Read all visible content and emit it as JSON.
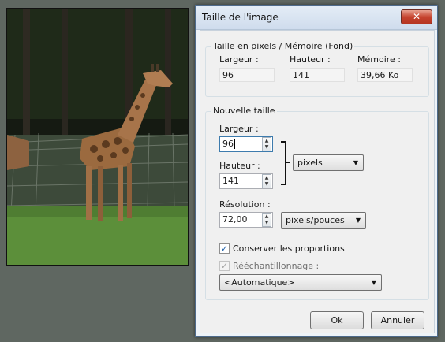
{
  "dialog": {
    "title": "Taille de l'image",
    "close_glyph": "✕"
  },
  "memory_group": {
    "legend": "Taille en pixels / Mémoire (Fond)",
    "width_label": "Largeur :",
    "width_value": "96",
    "height_label": "Hauteur :",
    "height_value": "141",
    "memory_label": "Mémoire :",
    "memory_value": "39,66 Ko"
  },
  "new_size_group": {
    "legend": "Nouvelle taille",
    "width_label": "Largeur :",
    "width_value": "96",
    "height_label": "Hauteur :",
    "height_value": "141",
    "unit_select": "pixels",
    "resolution_label": "Résolution :",
    "resolution_value": "72,00",
    "resolution_unit_select": "pixels/pouces",
    "keep_proportions_label": "Conserver les proportions",
    "keep_proportions_checked": true,
    "resampling_label": "Rééchantillonnage :",
    "resampling_checked": true,
    "resampling_enabled": false,
    "resampling_select": "<Automatique>"
  },
  "buttons": {
    "ok": "Ok",
    "cancel": "Annuler"
  },
  "icons": {
    "close": "close-icon",
    "spin_up": "spin-up-icon",
    "spin_down": "spin-down-icon",
    "dropdown": "chevron-down-icon",
    "check": "checkmark-icon"
  },
  "colors": {
    "workspace_bg": "#5f6761",
    "dialog_bg": "#f0f0f0",
    "close_button": "#c6442f"
  }
}
